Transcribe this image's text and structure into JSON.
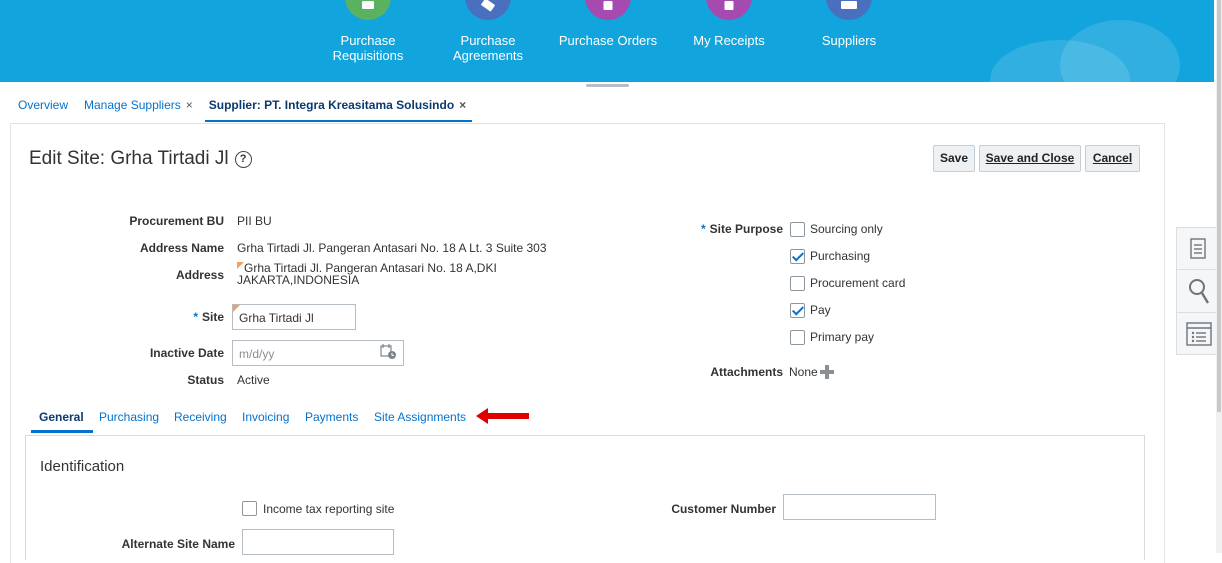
{
  "springboard": {
    "tiles": [
      {
        "label": "Purchase Requisitions",
        "color": "#5ab260",
        "icon": "cart-icon"
      },
      {
        "label": "Purchase Agreements",
        "color": "#4b6fbf",
        "icon": "handshake-icon"
      },
      {
        "label": "Purchase Orders",
        "color": "#a54bb0",
        "icon": "document-icon"
      },
      {
        "label": "My Receipts",
        "color": "#a54bb0",
        "icon": "receipt-icon"
      },
      {
        "label": "Suppliers",
        "color": "#4b6fbf",
        "icon": "suppliers-icon"
      }
    ]
  },
  "breadcrumbs": {
    "overview": "Overview",
    "manage_suppliers": "Manage Suppliers",
    "supplier": "Supplier: PT. Integra Kreasitama Solusindo",
    "close_glyph": "×"
  },
  "page": {
    "title": "Edit Site: Grha Tirtadi Jl",
    "help_glyph": "?"
  },
  "actions": {
    "save": "Save",
    "save_and_close": "Save and Close",
    "cancel": "Cancel"
  },
  "form": {
    "procurement_bu_label": "Procurement BU",
    "procurement_bu_value": "PII BU",
    "address_name_label": "Address Name",
    "address_name_value": "Grha Tirtadi Jl. Pangeran Antasari No. 18 A Lt. 3 Suite 303",
    "address_label": "Address",
    "address_line1": "Grha Tirtadi Jl. Pangeran Antasari No. 18 A,DKI",
    "address_line2": "JAKARTA,INDONESIA",
    "required_marker": "*",
    "site_label": "Site",
    "site_value": "Grha Tirtadi Jl",
    "inactive_date_label": "Inactive Date",
    "inactive_date_placeholder": "m/d/yy",
    "status_label": "Status",
    "status_value": "Active",
    "site_purpose_label": "Site Purpose",
    "site_purposes": [
      {
        "label": "Sourcing only",
        "checked": false
      },
      {
        "label": "Purchasing",
        "checked": true
      },
      {
        "label": "Procurement card",
        "checked": false
      },
      {
        "label": "Pay",
        "checked": true
      },
      {
        "label": "Primary pay",
        "checked": false
      }
    ],
    "attachments_label": "Attachments",
    "attachments_value": "None"
  },
  "tabs": [
    {
      "label": "General",
      "active": true
    },
    {
      "label": "Purchasing",
      "active": false
    },
    {
      "label": "Receiving",
      "active": false
    },
    {
      "label": "Invoicing",
      "active": false
    },
    {
      "label": "Payments",
      "active": false
    },
    {
      "label": "Site Assignments",
      "active": false
    }
  ],
  "identification": {
    "title": "Identification",
    "income_tax_label": "Income tax reporting site",
    "income_tax_checked": false,
    "customer_number_label": "Customer Number",
    "customer_number_value": "",
    "alternate_site_name_label": "Alternate Site Name",
    "alternate_site_name_value": ""
  },
  "colors": {
    "banner": "#12a4dc",
    "link": "#0572ce",
    "arrow": "#e00000"
  }
}
